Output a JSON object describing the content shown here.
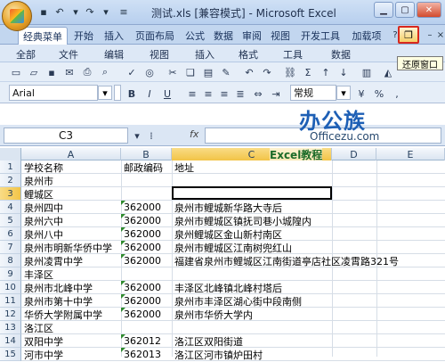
{
  "window": {
    "title": "测试.xls [兼容模式] - Microsoft Excel",
    "tooltip": "还原窗口"
  },
  "ribbon": {
    "tabs": [
      "经典菜单",
      "开始",
      "插入",
      "页面布局",
      "公式",
      "数据",
      "审阅",
      "视图",
      "开发工具",
      "加载项"
    ],
    "active_tab": "经典菜单"
  },
  "menus": [
    "全部",
    "文件",
    "编辑",
    "视图",
    "插入",
    "格式",
    "工具",
    "数据"
  ],
  "toolbar": {
    "font": "Arial",
    "number_format": "常规"
  },
  "watermark": {
    "logo": "办公族",
    "site": "Officezu.com",
    "banner": "Excel教程"
  },
  "formula_bar": {
    "name_box": "C3",
    "fx": "fx",
    "value": ""
  },
  "sheet": {
    "columns": [
      "A",
      "B",
      "C",
      "D",
      "E"
    ],
    "selected_column": "C",
    "selected_row": 3,
    "rows": [
      {
        "n": "1",
        "a": "学校名称",
        "b": "邮政编码",
        "c": "地址",
        "tri": false
      },
      {
        "n": "2",
        "a": "泉州市",
        "b": "",
        "c": "",
        "tri": false
      },
      {
        "n": "3",
        "a": "鲤城区",
        "b": "",
        "c": "",
        "tri": false
      },
      {
        "n": "4",
        "a": "泉州四中",
        "b": "362000",
        "c": "泉州市鲤城新华路大寺后",
        "tri": true
      },
      {
        "n": "5",
        "a": "泉州六中",
        "b": "362000",
        "c": "泉州市鲤城区镇抚司巷小城隍内",
        "tri": true
      },
      {
        "n": "6",
        "a": "泉州八中",
        "b": "362000",
        "c": "泉州鲤城区金山新村南区",
        "tri": true
      },
      {
        "n": "7",
        "a": "泉州市明新华侨中学",
        "b": "362000",
        "c": "泉州市鲤城区江南树兜红山",
        "tri": true
      },
      {
        "n": "8",
        "a": "泉州凌霄中学",
        "b": "362000",
        "c": "福建省泉州市鲤城区江南街道亭店社区凌霄路321号",
        "tri": true
      },
      {
        "n": "9",
        "a": "丰泽区",
        "b": "",
        "c": "",
        "tri": false
      },
      {
        "n": "10",
        "a": "泉州市北峰中学",
        "b": "362000",
        "c": "丰泽区北峰镇北峰村塔后",
        "tri": true
      },
      {
        "n": "11",
        "a": "泉州市第十中学",
        "b": "362000",
        "c": "泉州市丰泽区湖心街中段南侧",
        "tri": true
      },
      {
        "n": "12",
        "a": "华侨大学附属中学",
        "b": "362000",
        "c": "泉州市华侨大学内",
        "tri": true
      },
      {
        "n": "13",
        "a": "洛江区",
        "b": "",
        "c": "",
        "tri": false
      },
      {
        "n": "14",
        "a": "双阳中学",
        "b": "362012",
        "c": "洛江区双阳街道",
        "tri": true
      },
      {
        "n": "15",
        "a": "河市中学",
        "b": "362013",
        "c": "洛江区河市镇炉田村",
        "tri": true
      }
    ]
  }
}
